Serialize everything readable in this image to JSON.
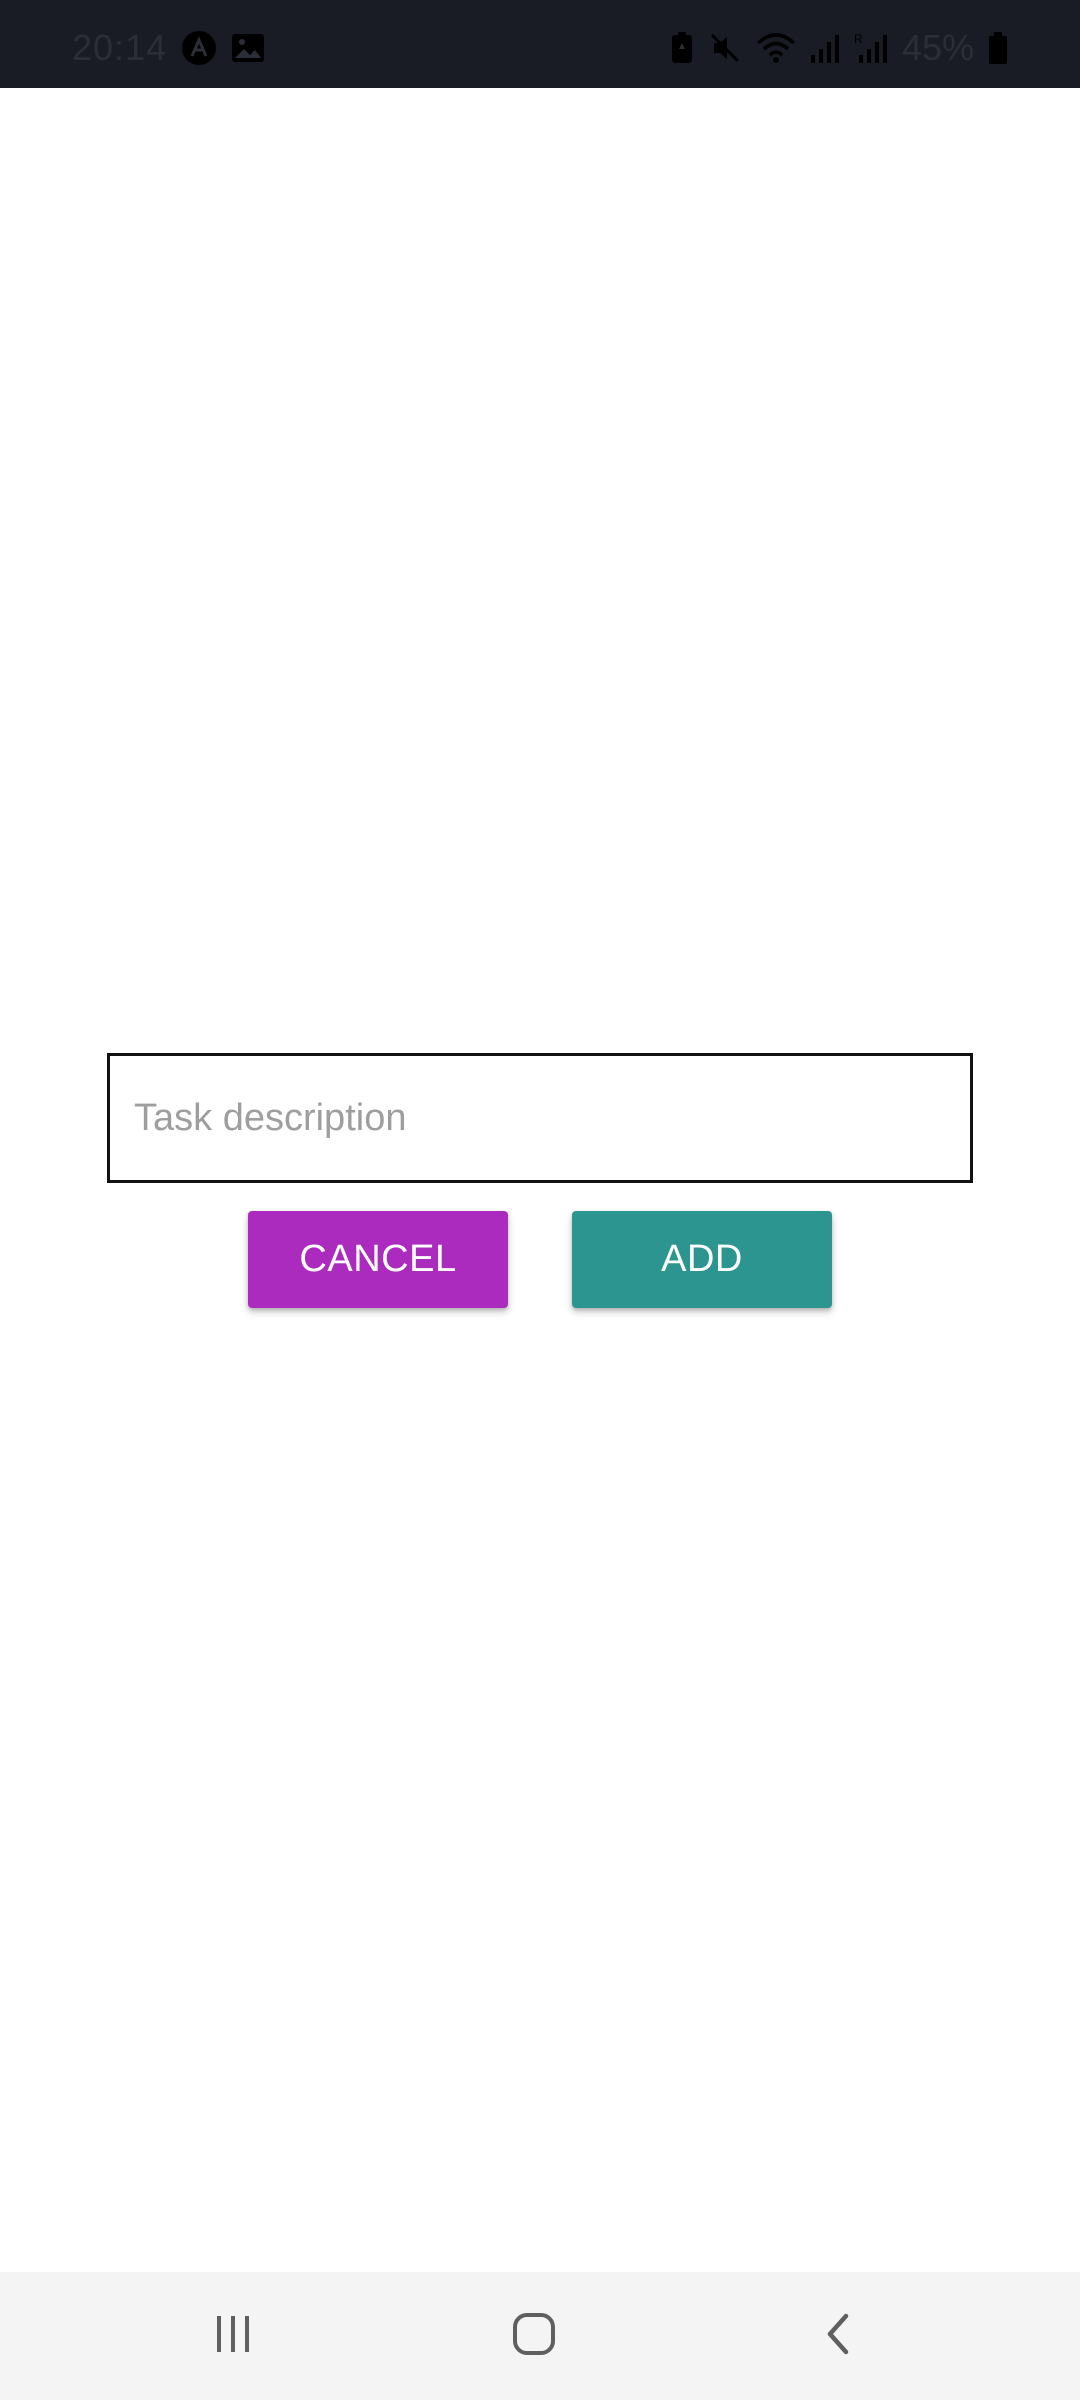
{
  "status_bar": {
    "time": "20:14",
    "battery": "45%",
    "left_icons": [
      "app-notification-icon",
      "image-notification-icon"
    ],
    "right_icons": [
      "battery-saver-icon",
      "mute-icon",
      "wifi-icon",
      "signal-icon",
      "signal-roaming-icon",
      "battery-icon"
    ]
  },
  "form": {
    "task_placeholder": "Task description",
    "task_value": ""
  },
  "buttons": {
    "cancel_label": "CANCEL",
    "add_label": "ADD"
  },
  "colors": {
    "cancel": "#ac2bbf",
    "add": "#2c9590",
    "status_bar": "#191c24",
    "nav_bar": "#f4f4f4"
  },
  "nav_bar": {
    "icons": [
      "recents-icon",
      "home-icon",
      "back-icon"
    ]
  }
}
